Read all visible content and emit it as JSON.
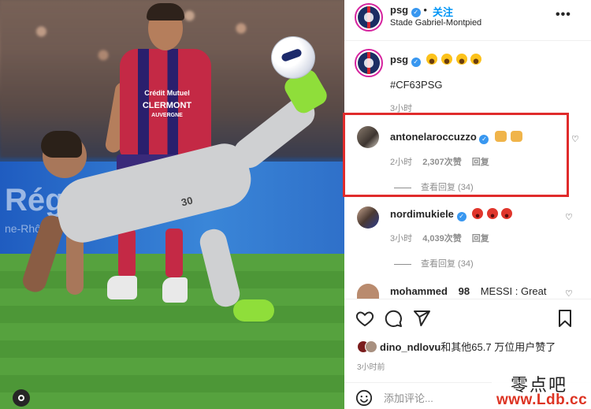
{
  "post": {
    "username": "psg",
    "follow_label": "关注",
    "location": "Stade Gabriel-Montpied",
    "more_label": "•••"
  },
  "photo": {
    "billboard_text": "Rég",
    "billboard_sub": "ne-Rhô",
    "sponsor_line1": "Crédit Mutuel",
    "sponsor_line2": "CLERMONT",
    "sponsor_line3": "AUVERGNE",
    "shirt_number": "30"
  },
  "caption": {
    "username": "psg",
    "emojis": [
      "😮",
      "😮",
      "😮",
      "😮"
    ],
    "hashtag": "#CF63PSG",
    "time": "3小时"
  },
  "comments": [
    {
      "username": "antonelaroccuzzo",
      "emojis": [
        "🙌",
        "🙌"
      ],
      "time": "2小时",
      "likes": "2,307次赞",
      "reply": "回复",
      "view_replies": "查看回复 (34)",
      "highlighted": true
    },
    {
      "username": "nordimukiele",
      "emojis": [
        "😡",
        "😡",
        "😡"
      ],
      "time": "3小时",
      "likes": "4,039次赞",
      "reply": "回复",
      "view_replies": "查看回复 (34)",
      "highlighted": false
    },
    {
      "username": "mohammed",
      "suffix": "98",
      "text": "MESSI : Great"
    }
  ],
  "actions": {
    "like_icon": "heart-icon",
    "comment_icon": "comment-icon",
    "share_icon": "send-icon",
    "save_icon": "bookmark-icon"
  },
  "likes_summary": {
    "user": "dino_ndlovu",
    "rest": "和其他65.7 万位用户赞了"
  },
  "time_ago": "3小时前",
  "comment_box": {
    "placeholder": "添加评论...",
    "emoji_icon": "smiley-icon"
  },
  "watermark": {
    "line1": "零点吧",
    "line2": "www.Ldb.cc"
  },
  "colors": {
    "highlight_border": "#e02b2b",
    "link_blue": "#0095f6",
    "verified_blue": "#3897f0"
  }
}
